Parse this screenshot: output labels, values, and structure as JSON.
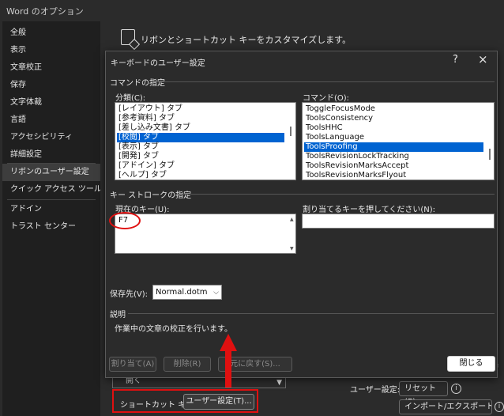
{
  "window": {
    "title": "Word のオプション"
  },
  "sidebar": {
    "items": [
      {
        "label": "全般"
      },
      {
        "label": "表示"
      },
      {
        "label": "文章校正"
      },
      {
        "label": "保存"
      },
      {
        "label": "文字体裁"
      },
      {
        "label": "言語"
      },
      {
        "label": "アクセシビリティ"
      },
      {
        "label": "詳細設定"
      },
      {
        "label": "リボンのユーザー設定",
        "active": true
      },
      {
        "label": "クイック アクセス ツール バー"
      },
      {
        "label": "アドイン"
      },
      {
        "label": "トラスト センター"
      }
    ]
  },
  "main": {
    "header": "リボンとショートカット キーをカスタマイズします。",
    "open_combo": "開く",
    "shortcut_label": "ショートカット キー:",
    "customize_button": "ユーザー設定(T)...",
    "user_settings_label": "ユーザー設定:",
    "reset_button": "リセット(E) ▾",
    "import_export_button": "インポート/エクスポート(P) ▾"
  },
  "dialog": {
    "title": "キーボードのユーザー設定",
    "help": "?",
    "close_icon": "×",
    "command_spec_section": "コマンドの指定",
    "category_label": "分類(C):",
    "categories": [
      {
        "label": "[レイアウト] タブ"
      },
      {
        "label": "[参考資料] タブ"
      },
      {
        "label": "[差し込み文書] タブ"
      },
      {
        "label": "[校閲] タブ",
        "selected": true
      },
      {
        "label": "[表示] タブ"
      },
      {
        "label": "[開発] タブ"
      },
      {
        "label": "[アドイン] タブ"
      },
      {
        "label": "[ヘルプ] タブ"
      }
    ],
    "command_label": "コマンド(O):",
    "commands": [
      {
        "label": "ToggleFocusMode"
      },
      {
        "label": "ToolsConsistency"
      },
      {
        "label": "ToolsHHC"
      },
      {
        "label": "ToolsLanguage"
      },
      {
        "label": "ToolsProofing",
        "selected": true
      },
      {
        "label": "ToolsRevisionLockTracking"
      },
      {
        "label": "ToolsRevisionMarksAccept"
      },
      {
        "label": "ToolsRevisionMarksFlyout"
      }
    ],
    "keystroke_section": "キー ストロークの指定",
    "current_keys_label": "現在のキー(U):",
    "current_keys": [
      "F7"
    ],
    "new_key_label": "割り当てるキーを押してください(N):",
    "new_key_value": "",
    "save_in_label": "保存先(V):",
    "save_in_value": "Normal.dotm",
    "description_section": "説明",
    "description_text": "作業中の文章の校正を行います。",
    "buttons": {
      "assign": "割り当て(A)",
      "remove": "削除(R)",
      "reset_all": "元に戻す(S)...",
      "close": "閉じる"
    }
  },
  "annotations": {
    "highlight_color": "#e01010"
  }
}
